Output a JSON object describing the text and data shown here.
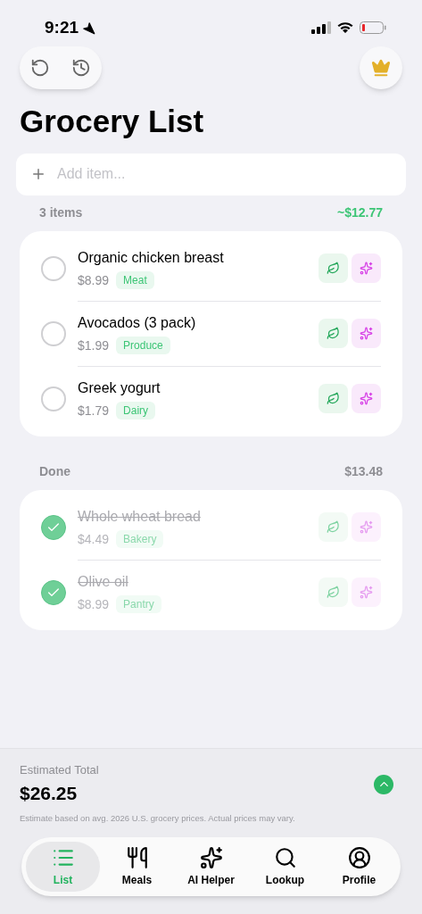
{
  "status_bar": {
    "time": "9:21"
  },
  "title": "Grocery List",
  "add_field": {
    "placeholder": "Add item..."
  },
  "sections": [
    {
      "label": "3 items",
      "total": "~$12.77",
      "highlighted": true,
      "items": [
        {
          "name": "Organic chicken breast",
          "price": "$8.99",
          "category": "Meat",
          "checked": false
        },
        {
          "name": "Avocados (3 pack)",
          "price": "$1.99",
          "category": "Produce",
          "checked": false
        },
        {
          "name": "Greek yogurt",
          "price": "$1.79",
          "category": "Dairy",
          "checked": false
        }
      ]
    },
    {
      "label": "Done",
      "total": "$13.48",
      "highlighted": false,
      "items": [
        {
          "name": "Whole wheat bread",
          "price": "$4.49",
          "category": "Bakery",
          "checked": true
        },
        {
          "name": "Olive oil",
          "price": "$8.99",
          "category": "Pantry",
          "checked": true
        }
      ]
    }
  ],
  "footer": {
    "label": "Estimated Total",
    "total": "$26.25",
    "note": "Estimate based on avg. 2026 U.S. grocery prices. Actual prices may vary."
  },
  "tabs": [
    {
      "label": "List",
      "kind": "list",
      "selected": true
    },
    {
      "label": "Meals",
      "kind": "meals",
      "selected": false
    },
    {
      "label": "AI Helper",
      "kind": "ai",
      "selected": false
    },
    {
      "label": "Lookup",
      "kind": "lookup",
      "selected": false
    },
    {
      "label": "Profile",
      "kind": "profile",
      "selected": false
    }
  ]
}
